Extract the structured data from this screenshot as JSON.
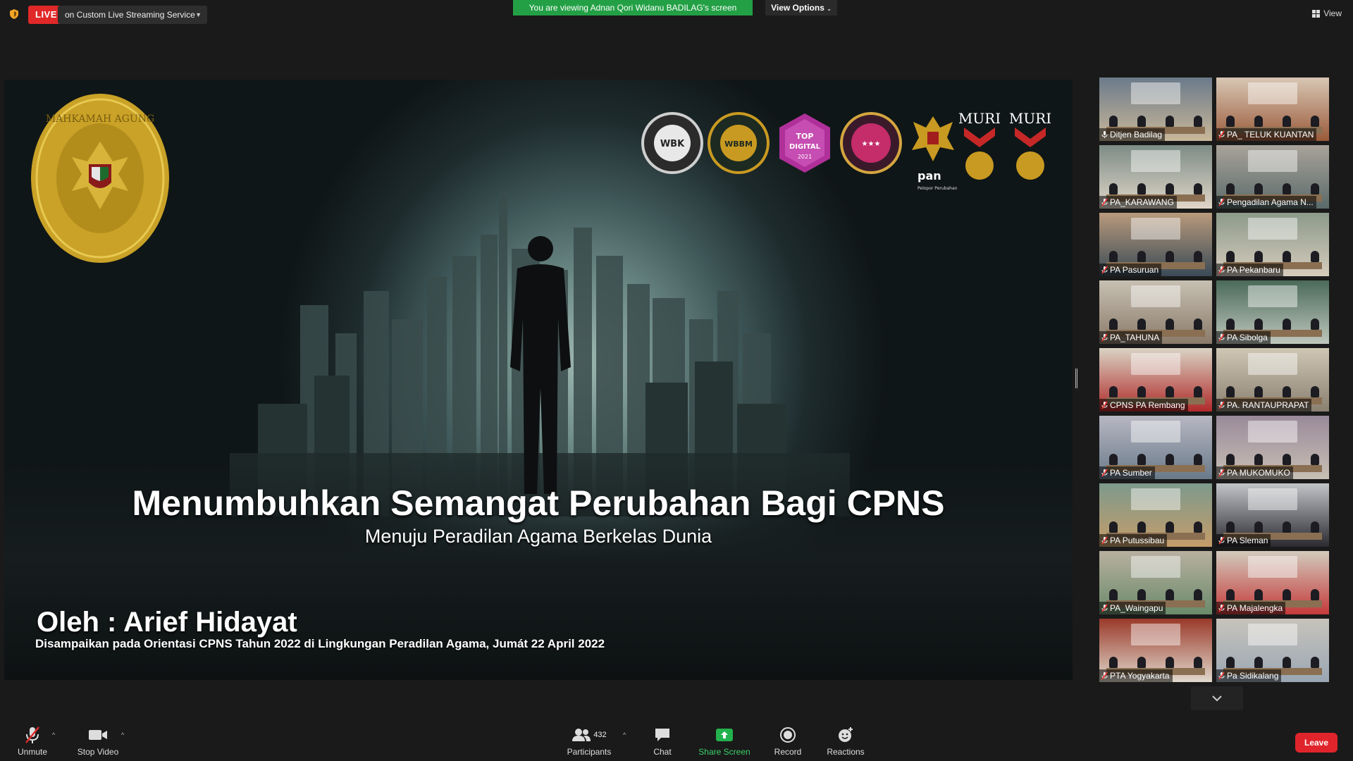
{
  "top_bar": {
    "live_label": "LIVE",
    "live_target": "on Custom Live Streaming Service",
    "viewing_banner": "You are viewing Adnan Qori Widanu BADILAG's screen",
    "view_options_label": "View Options",
    "view_label": "View"
  },
  "slide": {
    "title": "Menumbuhkan Semangat Perubahan Bagi CPNS",
    "subtitle": "Menuju Peradilan Agama Berkelas Dunia",
    "speaker": "Oleh : Arief Hidayat",
    "event_line": "Disampaikan pada Orientasi CPNS Tahun 2022 di Lingkungan Peradilan Agama, Jumát 22 April 2022",
    "seal_text": "MAHKAMAH AGUNG",
    "logos": {
      "wbk": "WBK",
      "wbbm": "WBBM",
      "top_digital": "TOP DIGITAL AWARDS 2021",
      "top_digital_short": "TOP",
      "top_digital_word": "DIGITAL",
      "top_digital_year": "2021",
      "pan": "pan",
      "pan_caption": "Pelopor Perubahan Pembangunan Zona Integritas",
      "muri": "MURI"
    }
  },
  "participants": [
    {
      "name": "Ditjen Badilag",
      "active": true,
      "muted": false
    },
    {
      "name": "PA_ TELUK KUANTAN",
      "muted": true
    },
    {
      "name": "PA_KARAWANG",
      "muted": true
    },
    {
      "name": "Pengadilan Agama N...",
      "muted": true
    },
    {
      "name": "PA Pasuruan",
      "muted": true
    },
    {
      "name": "PA Pekanbaru",
      "muted": true
    },
    {
      "name": "PA_TAHUNA",
      "muted": true
    },
    {
      "name": "PA Sibolga",
      "muted": true
    },
    {
      "name": "CPNS PA Rembang",
      "muted": true
    },
    {
      "name": "PA. RANTAUPRAPAT",
      "muted": true
    },
    {
      "name": "PA Sumber",
      "muted": true
    },
    {
      "name": "PA MUKOMUKO",
      "muted": true
    },
    {
      "name": "PA Putussibau",
      "muted": true
    },
    {
      "name": "PA Sleman",
      "muted": true
    },
    {
      "name": "PA_Waingapu",
      "muted": true
    },
    {
      "name": "PA Majalengka",
      "muted": true
    },
    {
      "name": "PTA Yogyakarta",
      "muted": true
    },
    {
      "name": "Pa Sidikalang",
      "muted": true
    }
  ],
  "toolbar": {
    "unmute_label": "Unmute",
    "stop_video_label": "Stop Video",
    "participants_label": "Participants",
    "participants_count": "432",
    "chat_label": "Chat",
    "share_screen_label": "Share Screen",
    "record_label": "Record",
    "reactions_label": "Reactions",
    "leave_label": "Leave"
  },
  "colors": {
    "live_red": "#e02828",
    "viewing_green": "#23a045",
    "share_green": "#23b14d",
    "leave_red": "#e0242b",
    "active_speaker_outline": "#d8e24a"
  }
}
